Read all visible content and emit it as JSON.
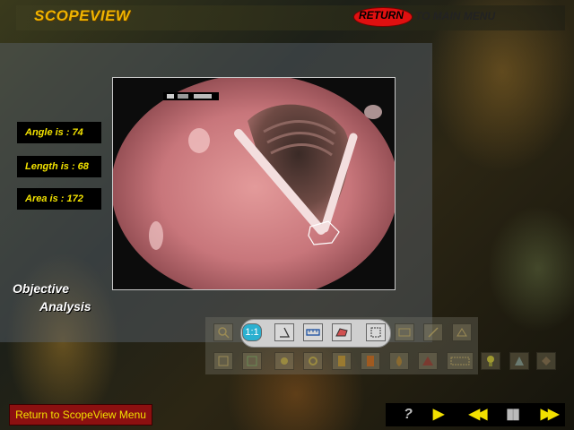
{
  "app": {
    "title": "SCOPEVIEW"
  },
  "header": {
    "return_label": "RETURN",
    "to_main_menu_label": "TO MAIN MENU"
  },
  "measurements": [
    {
      "label": "Angle is : 74"
    },
    {
      "label": "Length is : 68"
    },
    {
      "label": "Area is : 172"
    }
  ],
  "section": {
    "line1": "Objective",
    "line2": "Analysis"
  },
  "toolbar": {
    "row1_icons": [
      "magnify-icon",
      "zoom-1-1-icon",
      "measure-angle-icon",
      "measure-length-icon",
      "measure-area-icon",
      "select-region-icon",
      "annotate-icon",
      "draw-icon",
      "erase-icon"
    ],
    "row2_icons": [
      "frame-icon",
      "play-frame-icon",
      "brightness-icon",
      "contrast-icon",
      "color-icon",
      "tone-icon",
      "flame-icon",
      "shape-icon",
      "grid-icon",
      "light-icon",
      "triangle-icon",
      "square-icon"
    ],
    "zoom_label": "1:1"
  },
  "footer": {
    "menu_button": "Return to ScopeView Menu",
    "help": "?",
    "play": "▶",
    "rewind": "◀◀",
    "pause": "▮▮",
    "fast_forward": "▶▶"
  },
  "colors": {
    "accent_yellow": "#f2e000",
    "return_red": "#e01010",
    "menu_button_bg": "#8c1010"
  }
}
